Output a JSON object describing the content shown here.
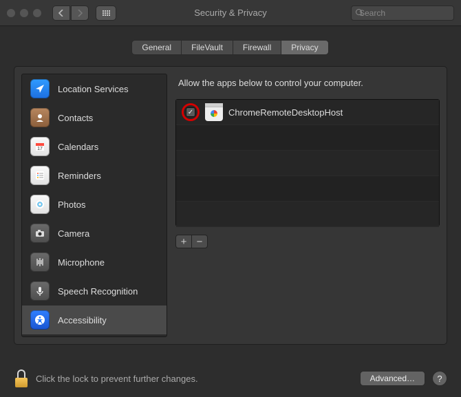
{
  "window": {
    "title": "Security & Privacy",
    "search_placeholder": "Search"
  },
  "tabs": [
    {
      "label": "General",
      "active": false
    },
    {
      "label": "FileVault",
      "active": false
    },
    {
      "label": "Firewall",
      "active": false
    },
    {
      "label": "Privacy",
      "active": true
    }
  ],
  "sidebar": {
    "items": [
      {
        "label": "Location Services",
        "icon": "location",
        "colors": [
          "#2f9bff",
          "#1d6fe0"
        ],
        "selected": false
      },
      {
        "label": "Contacts",
        "icon": "contacts",
        "colors": [
          "#b8875f",
          "#8a5e3b"
        ],
        "selected": false
      },
      {
        "label": "Calendars",
        "icon": "calendar",
        "colors": [
          "#fafafa",
          "#e2e2e2"
        ],
        "selected": false
      },
      {
        "label": "Reminders",
        "icon": "reminders",
        "colors": [
          "#fafafa",
          "#e2e2e2"
        ],
        "selected": false
      },
      {
        "label": "Photos",
        "icon": "photos",
        "colors": [
          "#fafafa",
          "#e2e2e2"
        ],
        "selected": false
      },
      {
        "label": "Camera",
        "icon": "camera",
        "colors": [
          "#6b6b6b",
          "#4e4e4e"
        ],
        "selected": false
      },
      {
        "label": "Microphone",
        "icon": "microphone",
        "colors": [
          "#6b6b6b",
          "#4e4e4e"
        ],
        "selected": false
      },
      {
        "label": "Speech Recognition",
        "icon": "speech",
        "colors": [
          "#6b6b6b",
          "#4e4e4e"
        ],
        "selected": false
      },
      {
        "label": "Accessibility",
        "icon": "accessibility",
        "colors": [
          "#2f7fff",
          "#1a55d0"
        ],
        "selected": true
      }
    ]
  },
  "content": {
    "title": "Allow the apps below to control your computer.",
    "apps": [
      {
        "name": "ChromeRemoteDesktopHost",
        "checked": true,
        "highlighted": true
      }
    ],
    "add_label": "+",
    "remove_label": "−"
  },
  "footer": {
    "lock_text": "Click the lock to prevent further changes.",
    "advanced_label": "Advanced…",
    "help_label": "?"
  }
}
